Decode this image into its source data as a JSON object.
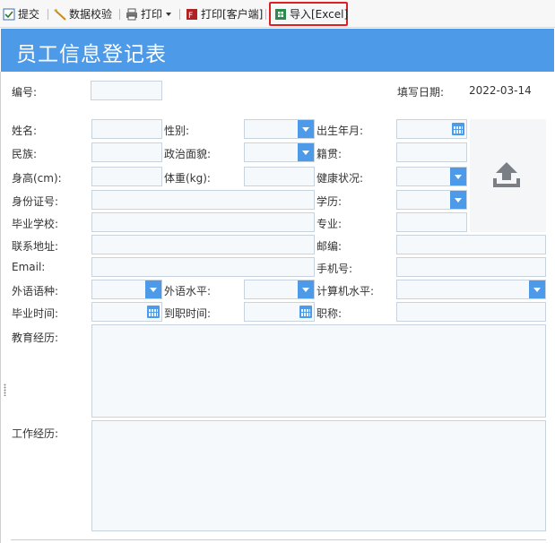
{
  "toolbar": {
    "submit": "提交",
    "validate": "数据校验",
    "print": "打印",
    "print_client": "打印[客户端]",
    "import_excel": "导入[Excel]"
  },
  "form": {
    "title": "员工信息登记表",
    "number_label": "编号:",
    "fill_date_label": "填写日期:",
    "fill_date_value": "2022-03-14",
    "name_label": "姓名:",
    "gender_label": "性别:",
    "birth_label": "出生年月:",
    "ethnicity_label": "民族:",
    "political_label": "政治面貌:",
    "native_label": "籍贯:",
    "height_label": "身高(cm):",
    "weight_label": "体重(kg):",
    "health_label": "健康状况:",
    "id_label": "身份证号:",
    "education_label": "学历:",
    "school_label": "毕业学校:",
    "major_label": "专业:",
    "address_label": "联系地址:",
    "postcode_label": "邮编:",
    "email_label": "Email:",
    "mobile_label": "手机号:",
    "language_label": "外语语种:",
    "language_level_label": "外语水平:",
    "computer_level_label": "计算机水平:",
    "graduation_label": "毕业时间:",
    "entry_label": "到职时间:",
    "job_title_label": "职称:",
    "edu_history_label": "教育经历:",
    "work_history_label": "工作经历:"
  },
  "colors": {
    "accent": "#4d9ae8",
    "highlight": "#e02020"
  }
}
